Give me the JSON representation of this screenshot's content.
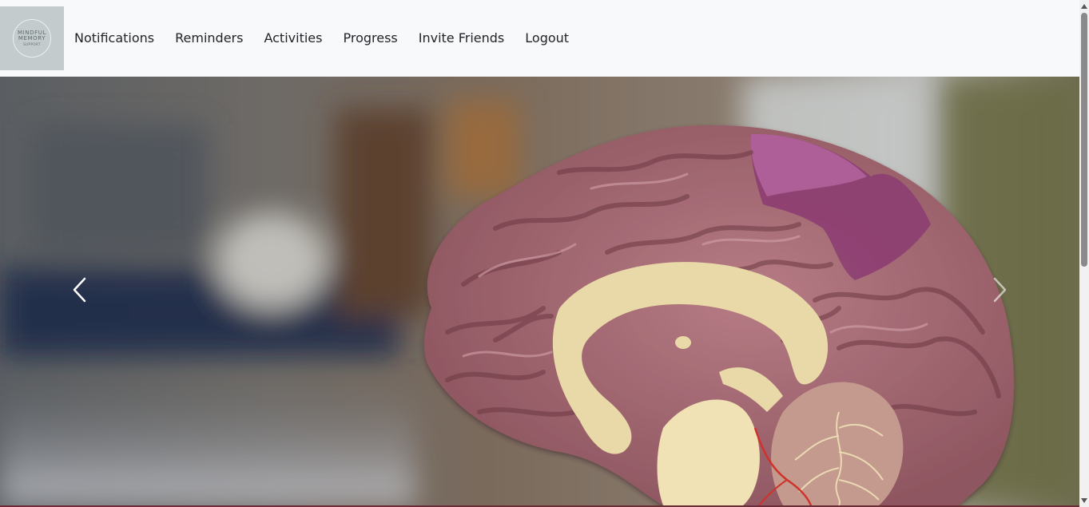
{
  "brand": {
    "line1": "MINDFUL",
    "line2": "MEMORY",
    "line3": "SUPPORT"
  },
  "nav": {
    "items": [
      {
        "label": "Notifications"
      },
      {
        "label": "Reminders"
      },
      {
        "label": "Activities"
      },
      {
        "label": "Progress"
      },
      {
        "label": "Invite Friends"
      },
      {
        "label": "Logout"
      }
    ]
  },
  "carousel": {
    "icons": {
      "prev": "chevron-left-icon",
      "next": "chevron-right-icon"
    }
  },
  "colors": {
    "navbar_bg": "#f8f9fa",
    "link_text": "#212529",
    "brain_tissue": "#a86b74",
    "brain_highlight": "#7a2f5e",
    "corpus_callosum": "#e8d9a8"
  }
}
